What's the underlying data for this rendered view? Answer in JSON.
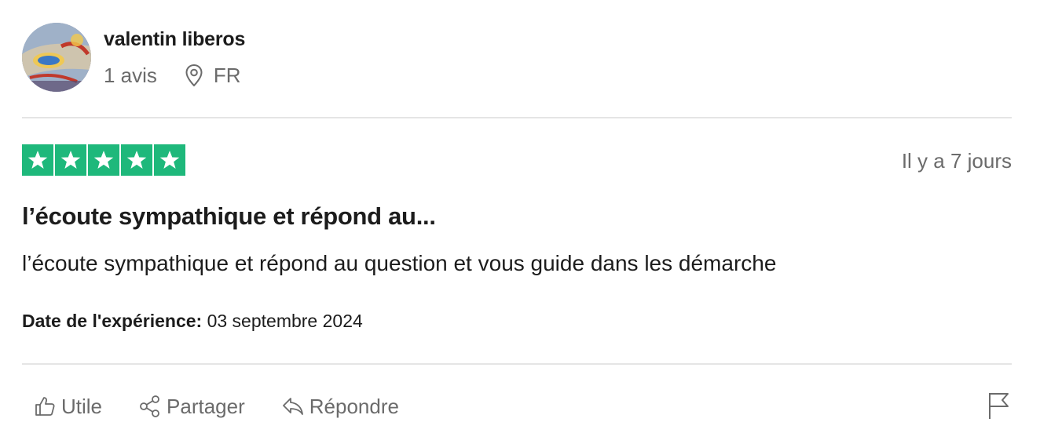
{
  "reviewer": {
    "name": "valentin liberos",
    "review_count": "1 avis",
    "country": "FR"
  },
  "review": {
    "rating": 5,
    "rating_max": 5,
    "star_color": "#1eb87b",
    "relative_date": "Il y a 7 jours",
    "title": "l’écoute sympathique et répond au...",
    "body": "l’écoute sympathique et répond au question et vous guide dans les démarche",
    "experience_label": "Date de l'expérience:",
    "experience_date": "03 septembre 2024"
  },
  "actions": {
    "useful_label": "Utile",
    "share_label": "Partager",
    "reply_label": "Répondre"
  },
  "icons": [
    "location-pin-icon",
    "star-icon",
    "thumbs-up-icon",
    "share-icon",
    "reply-icon",
    "flag-icon"
  ]
}
